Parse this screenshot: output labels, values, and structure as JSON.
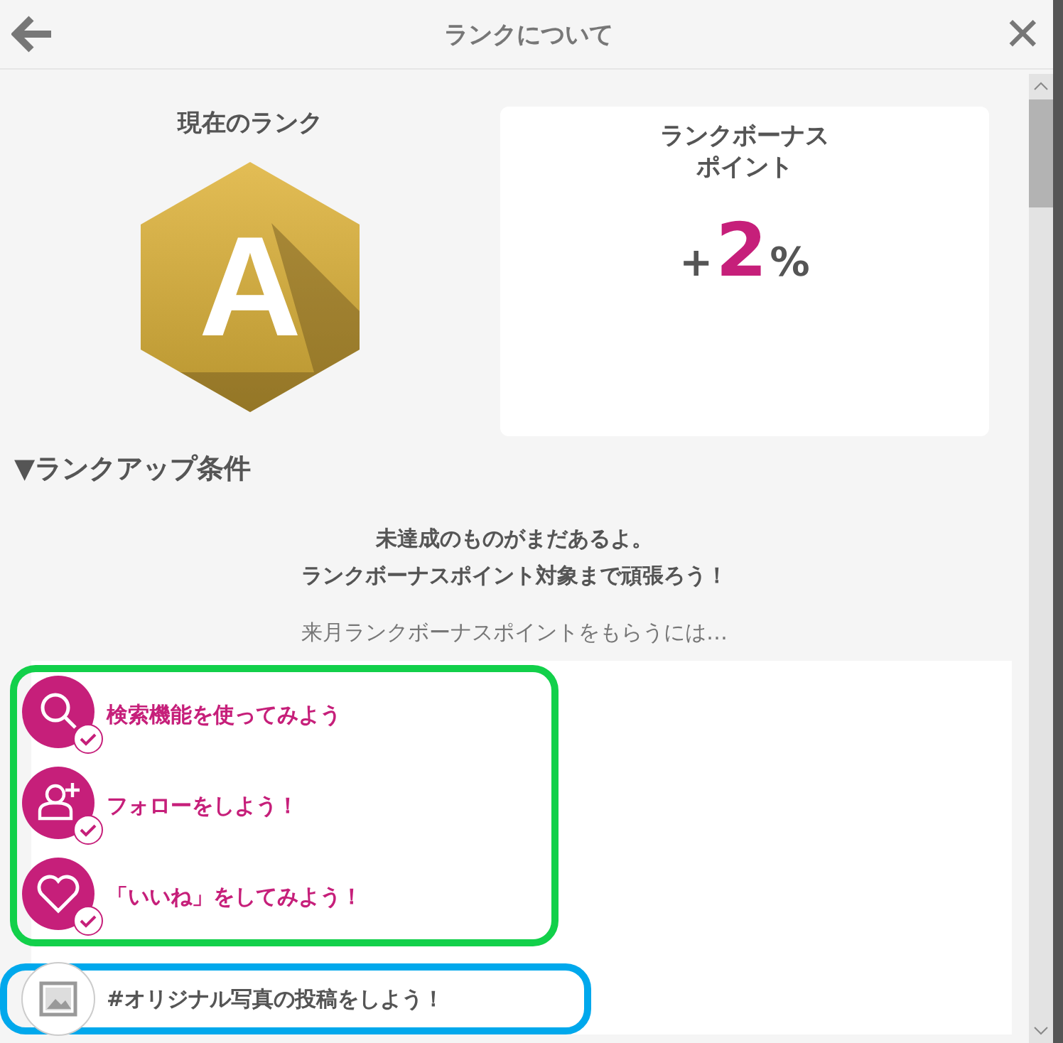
{
  "header": {
    "title": "ランクについて",
    "close": "✕"
  },
  "current_rank": {
    "label": "現在のランク",
    "rank": "A"
  },
  "bonus": {
    "label": [
      "ランクボーナス",
      "ポイント"
    ],
    "sign": "+",
    "value": "2",
    "unit": "%"
  },
  "section": {
    "title": "▼ランクアップ条件"
  },
  "message": [
    "未達成のものがまだあるよ。",
    "ランクボーナスポイント対象まで頑張ろう！"
  ],
  "hint": "来月ランクボーナスポイントをもらうには…",
  "groups": [
    {
      "color": "#12d04a",
      "tasks": [
        {
          "kind": "search",
          "label": "検索機能を使ってみよう",
          "achieved": true
        },
        {
          "kind": "follow",
          "label": "フォローをしよう！",
          "achieved": true
        },
        {
          "kind": "like",
          "label": "「いいね」をしてみよう！",
          "achieved": true
        }
      ]
    },
    {
      "color": "#00a8ec",
      "tasks": [
        {
          "kind": "photo",
          "label": "#オリジナル写真の投稿をしよう！",
          "achieved": false
        }
      ]
    }
  ]
}
